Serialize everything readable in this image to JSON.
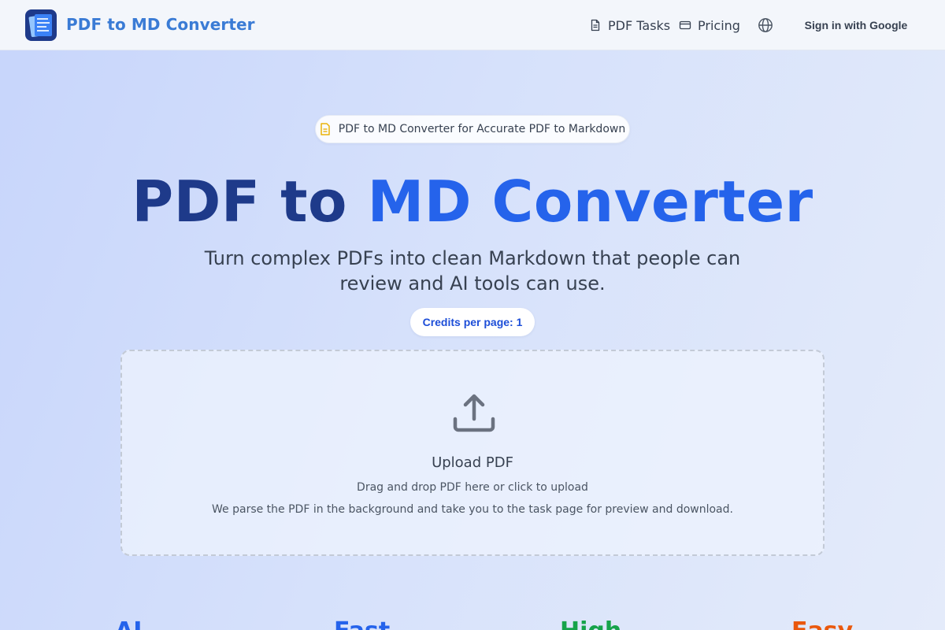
{
  "nav": {
    "brand": "PDF to MD Converter",
    "links": [
      {
        "label": "PDF Tasks",
        "icon": "document-icon"
      },
      {
        "label": "Pricing",
        "icon": "credit-card-icon"
      }
    ],
    "language_icon": "globe-icon",
    "signin_label": "Sign in with Google"
  },
  "hero": {
    "badge": "PDF to MD Converter for Accurate PDF to Markdown",
    "title_part1": "PDF to",
    "title_part2": "MD Converter",
    "subtitle": "Turn complex PDFs into clean Markdown that people can review and AI tools can use.",
    "credits": "Credits per page: 1"
  },
  "upload": {
    "icon": "upload-icon",
    "title": "Upload PDF",
    "instruction": "Drag and drop PDF here or click to upload",
    "description": "We parse the PDF in the background and take you to the task page for preview and download."
  },
  "features": [
    {
      "label": "AI",
      "color": "#2563eb"
    },
    {
      "label": "Fast",
      "color": "#2563eb"
    },
    {
      "label": "High",
      "color": "#16a34a"
    },
    {
      "label": "Easy",
      "color": "#ea580c"
    }
  ],
  "colors": {
    "brand": "#3a7bd5",
    "title_dark": "#1e3a8a",
    "title_blue": "#2563eb",
    "badge_icon": "#eab308"
  }
}
